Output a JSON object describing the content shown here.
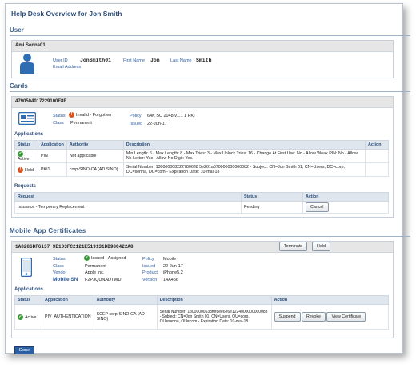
{
  "title": "Help Desk Overview for Jon Smith",
  "user": {
    "section": "User",
    "name": "Ami Senna01",
    "user_id_label": "User ID",
    "user_id": "JonSmith01",
    "email_label": "Email Address",
    "first_name_label": "First Name",
    "first_name": "Jon",
    "last_name_label": "Last Name",
    "last_name": "Smith"
  },
  "cards": {
    "section": "Cards",
    "card_id": "4790504017229100F8E",
    "status_label": "Status",
    "status": "Invalid - Forgotten",
    "class_label": "Class",
    "class": "Permanent",
    "policy_label": "Policy",
    "policy": "64K SC 2048 v1.1 1 PKI",
    "issued_label": "Issued",
    "issued": "22-Jun-17",
    "applications_title": "Applications",
    "app_headers": [
      "Status",
      "Application",
      "Authority",
      "Description",
      "Action"
    ],
    "apps": [
      {
        "status": "Active",
        "application": "PIN",
        "authority": "Not applicable",
        "description": "Min Length: 6 - Max Length: 8 - Max Tries: 3 - Max Unlock Tries: 16 - Change At First Use: No - Allow Weak PIN: No - Allow No Letter: Yes - Allow No Digit: Yes."
      },
      {
        "status": "Hold",
        "application": "PKI1",
        "authority": "corp-SINO-CA (AD SINO)",
        "description": "Serial Number: 130000008222780638 5e261a070000000000082 - Subject: CN=Jon Smith 01, CN=Users, DC=corp, DC=senna, DC=com - Expiration Date: 10-mai-18"
      }
    ],
    "requests_title": "Requests",
    "req_headers": [
      "Request",
      "Status",
      "Action"
    ],
    "request": {
      "name": "Issuance - Temporary Replacement",
      "status": "Pending",
      "action": "Cancel"
    }
  },
  "mobile": {
    "section": "Mobile App Certificates",
    "cert_id": "1A8286DF6137 9E103FC2121E519131DB98C422A8",
    "terminate": "Terminate",
    "hold": "Hold",
    "status_label": "Status",
    "status": "Issued - Assigned",
    "class_label": "Class",
    "class": "Permanent",
    "vendor_label": "Vendor",
    "vendor": "Apple Inc.",
    "mobile_sn_label": "Mobile SN",
    "mobile_sn": "F2P3QUNADTWD",
    "policy_label": "Policy",
    "policy": "Mobile",
    "issued_label": "Issued",
    "issued": "22-Jun-17",
    "product_label": "Product",
    "product": "iPhone5,2",
    "version_label": "Version",
    "version": "14A456",
    "applications_title": "Applications",
    "app_headers": [
      "Status",
      "Application",
      "Authority",
      "Description",
      "Action"
    ],
    "app": {
      "status": "Active",
      "application": "PIV_AUTHENTICATION",
      "authority": "SCEP corp-SINO-CA (AD SINO)",
      "description": "Serial Number: 13000000633f0f8ee6e6e1224000000000083 - Subject: CN=Jon Smith 01, CN=Users, OU=corp, OU=senna, OU=com - Expiration Date: 10-mai-18",
      "suspend": "Suspend",
      "revoke": "Revoke",
      "view": "View Certificate"
    }
  },
  "done": "Done"
}
